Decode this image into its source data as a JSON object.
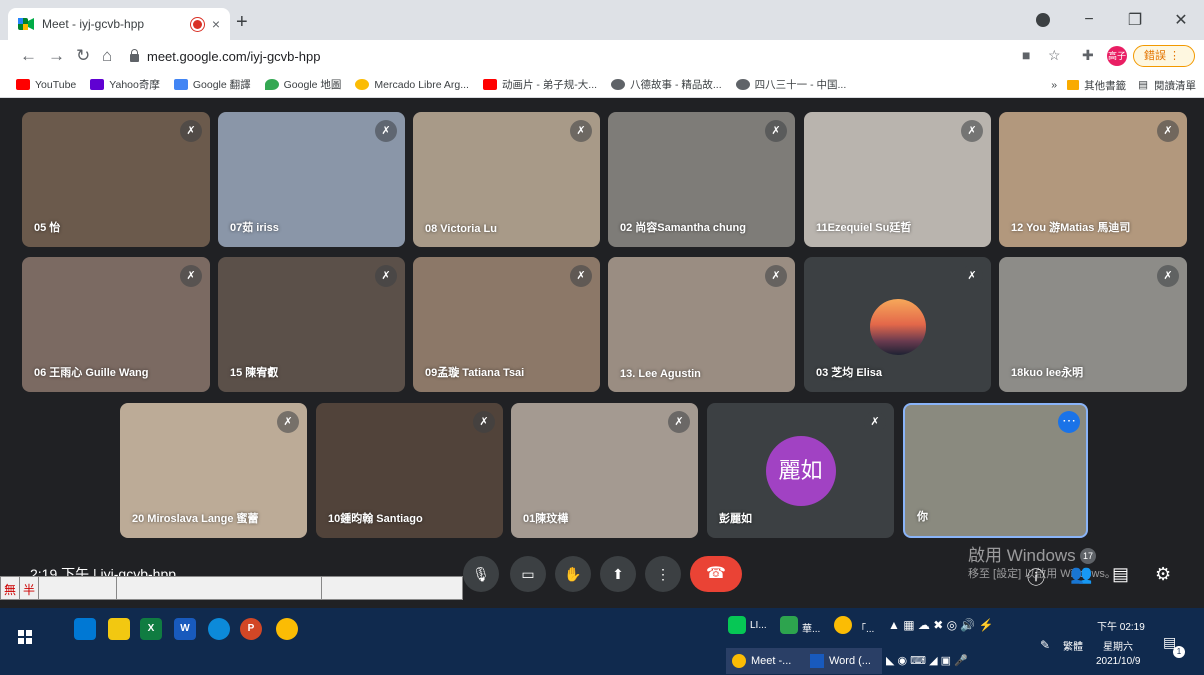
{
  "browser": {
    "tab_title": "Meet - iyj-gcvb-hpp",
    "tab_close": "×",
    "new_tab": "+",
    "url": "meet.google.com/iyj-gcvb-hpp",
    "profile_label": "高子",
    "update_label": "錯誤",
    "window_controls": [
      "−",
      "❐",
      "✕"
    ]
  },
  "bookmarks": [
    {
      "label": "YouTube",
      "color": "#ff0000"
    },
    {
      "label": "Yahoo奇摩",
      "color": "#6001d2"
    },
    {
      "label": "Google 翻譯",
      "color": "#4285f4"
    },
    {
      "label": "Google 地圖",
      "color": "#34a853"
    },
    {
      "label": "Mercado Libre Arg...",
      "color": "#fbbc04"
    },
    {
      "label": "动画片 - 弟子规-大...",
      "color": "#ff0000"
    },
    {
      "label": "八德故事 - 精品故...",
      "color": "#5f6368"
    },
    {
      "label": "四八三十一 - 中国...",
      "color": "#5f6368"
    }
  ],
  "bookmarks_right": {
    "overflow": "»",
    "other": "其他書籤",
    "reading": "閱讀清單"
  },
  "participants": [
    {
      "name": "05 怡",
      "bg": "#6b5a4c"
    },
    {
      "name": "07茹 iriss",
      "bg": "#8a96a8"
    },
    {
      "name": "08 Victoria Lu",
      "bg": "#a89a88"
    },
    {
      "name": "02 尚容Samantha chung",
      "bg": "#7e7c78"
    },
    {
      "name": "11Ezequiel Su廷哲",
      "bg": "#b9b4ae"
    },
    {
      "name": "12 You 游Matias 馬迪司",
      "bg": "#b2987d"
    },
    {
      "name": "06 王雨心 Guille Wang",
      "bg": "#7b6a62"
    },
    {
      "name": "15 陳宥叡",
      "bg": "#5b5049"
    },
    {
      "name": "09孟璇 Tatiana Tsai",
      "bg": "#8c7868"
    },
    {
      "name": "13. Lee Agustin",
      "bg": "#9a8d82"
    },
    {
      "name": "03 芝均 Elisa",
      "bg": "#3c4043"
    },
    {
      "name": "18kuo lee永明",
      "bg": "#8d8c88"
    },
    {
      "name": "20 Miroslava Lange 蜜蕾",
      "bg": "#bcab97"
    },
    {
      "name": "10鍾昀翰 Santiago",
      "bg": "#51433a"
    },
    {
      "name": "01陳玟樺",
      "bg": "#a49a91"
    },
    {
      "name": "彭麗如",
      "bg": "#3c4043",
      "avatar_text": "麗如"
    },
    {
      "name": "你",
      "bg": "#8a8a7f"
    }
  ],
  "meeting": {
    "time_code": "2:19 下午 | iyj-gcvb-hpp"
  },
  "watermark": {
    "line1": "啟用 Windows",
    "line2": "移至 [設定] 以啟用 Windows。"
  },
  "people_count": "17",
  "ime": [
    "無",
    "半"
  ],
  "taskbar": {
    "running": [
      {
        "label": "Meet -..."
      },
      {
        "label": "Word (..."
      }
    ],
    "tray_items": [
      "LI...",
      "華...",
      "「..."
    ],
    "lang": "繁體",
    "clock_time": "下午 02:19",
    "clock_day": "星期六",
    "clock_date": "2021/10/9",
    "notif_count": "1"
  }
}
